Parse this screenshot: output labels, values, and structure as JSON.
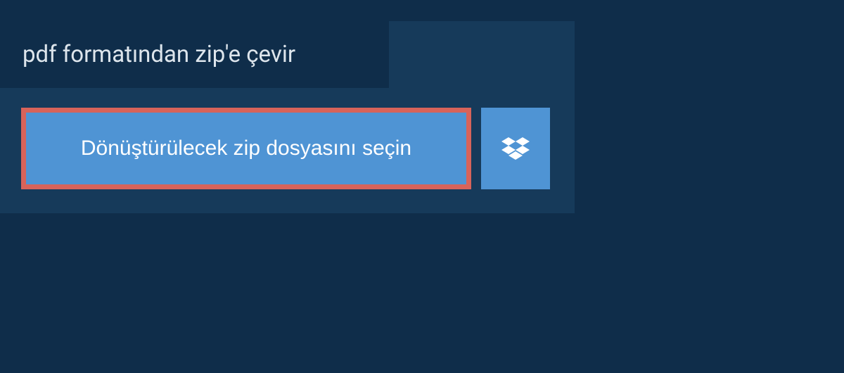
{
  "header": {
    "title": "pdf formatından zip'e çevir"
  },
  "buttons": {
    "select_file_label": "Dönüştürülecek zip dosyasını seçin",
    "dropbox_name": "dropbox-icon"
  },
  "colors": {
    "background": "#0f2d4a",
    "panel": "#163a5a",
    "button_primary": "#4f94d4",
    "button_highlight_border": "#d8635a",
    "text_light": "#dde5ec",
    "text_white": "#ffffff"
  }
}
